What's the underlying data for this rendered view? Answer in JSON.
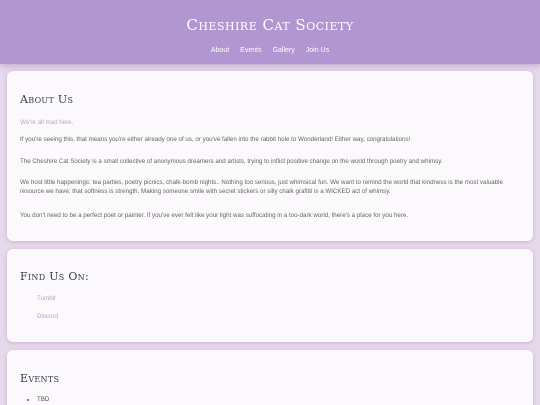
{
  "header": {
    "title": "Cheshire Cat Society",
    "nav": [
      "About",
      "Events",
      "Gallery",
      "Join Us"
    ]
  },
  "about": {
    "heading": "About Us",
    "tagline": "We're all mad here.",
    "paragraphs": [
      "If you're seeing this, that means you're either already one of us, or you've fallen into the rabbit hole to Wonderland! Either way, congratulations!",
      "The Cheshire Cat Society is a small collective of anonymous dreamers and artists, trying to inflict positive change on the world through poetry and whimsy.",
      "We host little happenings: tea parties, poetry picnics, chalk-bomb nights.. Nothing too serious, just whimsical fun. We want to remind the world that kindness is the most valuable resource we have; that softness is strength. Making someone smile with secret stickers or silly chalk grafitti is a WICKED act of whimsy.",
      "You don't need to be a perfect poet or painter. If you've ever felt like your light was suffocating in a too-dark world, there's a place for you here."
    ]
  },
  "find": {
    "heading": "Find Us On:",
    "links": [
      "Tumblr",
      "Discord"
    ]
  },
  "events": {
    "heading": "Events",
    "items": [
      "TBD"
    ]
  },
  "colors": {
    "header_bg": "#b296d2",
    "page_bg": "#e7d9ec",
    "accent": "#b7a0cf",
    "card_bg": "#fbf9fb"
  }
}
